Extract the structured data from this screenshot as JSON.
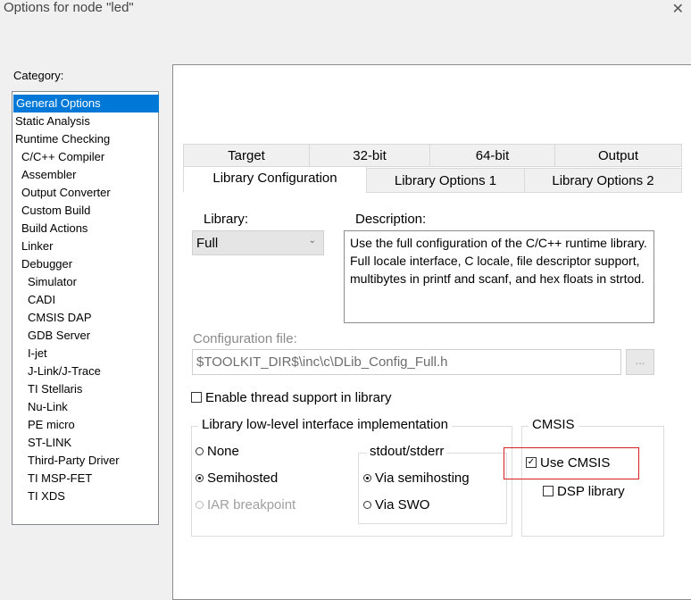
{
  "window": {
    "title": "Options for node \"led\"",
    "close_glyph": "✕"
  },
  "category": {
    "label": "Category:",
    "items": [
      {
        "label": "General Options"
      },
      {
        "label": "Static Analysis"
      },
      {
        "label": "Runtime Checking"
      },
      {
        "label": "C/C++ Compiler"
      },
      {
        "label": "Assembler"
      },
      {
        "label": "Output Converter"
      },
      {
        "label": "Custom Build"
      },
      {
        "label": "Build Actions"
      },
      {
        "label": "Linker"
      },
      {
        "label": "Debugger"
      },
      {
        "label": "Simulator"
      },
      {
        "label": "CADI"
      },
      {
        "label": "CMSIS DAP"
      },
      {
        "label": "GDB Server"
      },
      {
        "label": "I-jet"
      },
      {
        "label": "J-Link/J-Trace"
      },
      {
        "label": "TI Stellaris"
      },
      {
        "label": "Nu-Link"
      },
      {
        "label": "PE micro"
      },
      {
        "label": "ST-LINK"
      },
      {
        "label": "Third-Party Driver"
      },
      {
        "label": "TI MSP-FET"
      },
      {
        "label": "TI XDS"
      }
    ]
  },
  "tabs": {
    "row1": [
      {
        "label": "Target"
      },
      {
        "label": "32-bit"
      },
      {
        "label": "64-bit"
      },
      {
        "label": "Output"
      }
    ],
    "row2": [
      {
        "label": "Library Configuration"
      },
      {
        "label": "Library Options 1"
      },
      {
        "label": "Library Options 2"
      }
    ]
  },
  "library": {
    "label": "Library:",
    "selected": "Full",
    "description_label": "Description:",
    "description": "Use the full configuration of the C/C++ runtime library. Full locale interface, C locale, file descriptor support, multibytes in printf and scanf, and hex floats in strtod."
  },
  "config_file": {
    "label": "Configuration file:",
    "value": "$TOOLKIT_DIR$\\inc\\c\\DLib_Config_Full.h",
    "browse": "..."
  },
  "thread_support": {
    "label": "Enable thread support in library",
    "checked": false
  },
  "lowlevel": {
    "title": "Library low-level interface implementation",
    "options": [
      {
        "label": "None"
      },
      {
        "label": "Semihosted"
      },
      {
        "label": "IAR breakpoint"
      }
    ],
    "stdout_title": "stdout/stderr",
    "stdout_options": [
      {
        "label": "Via semihosting"
      },
      {
        "label": "Via SWO"
      }
    ]
  },
  "cmsis": {
    "title": "CMSIS",
    "use_cmsis": "Use CMSIS",
    "dsp_library": "DSP library",
    "checked_glyph": "✓"
  },
  "colors": {
    "selection": "#0078d7",
    "highlight_box": "#d42020"
  }
}
